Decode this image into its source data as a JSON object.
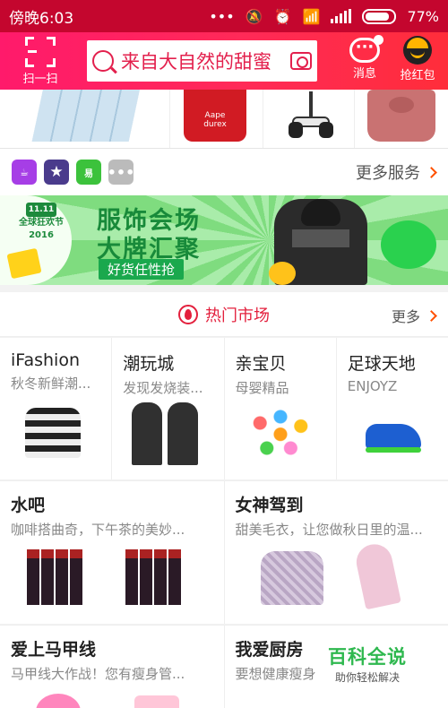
{
  "status_bar": {
    "time": "傍晚6:03",
    "icons": [
      "dots-icon",
      "mute-icon",
      "alarm-icon",
      "wifi-icon",
      "signal-icon",
      "battery-icon"
    ],
    "battery": "77%"
  },
  "header": {
    "scan_label": "扫一扫",
    "search_placeholder": "来自大自然的甜蜜",
    "message_label": "消息",
    "hongbao_label": "抢红包"
  },
  "product_strip": {
    "items": [
      "tissue-pack",
      "condom-box",
      "balance-scooter",
      "handbag"
    ],
    "aape_label": "Aape",
    "aape_sub": "durex"
  },
  "services": {
    "icons": [
      {
        "name": "tmall-ticket-icon",
        "glyph": "☕"
      },
      {
        "name": "star-icon",
        "glyph": "★"
      },
      {
        "name": "secondhand-icon",
        "glyph": "易"
      },
      {
        "name": "more-dots-icon",
        "glyph": "•••"
      }
    ],
    "more_label": "更多服务"
  },
  "banner": {
    "festival_line1": "11.11",
    "festival_line2": "全球狂欢节",
    "festival_line3": "2016",
    "title_line1": "服饰会场",
    "title_line2": "大牌汇聚",
    "tag": "好货任性抢"
  },
  "hot_market": {
    "title": "热门市场",
    "more_label": "更多"
  },
  "markets_row1": [
    {
      "title": "iFashion",
      "subtitle": "秋冬新鲜潮..."
    },
    {
      "title": "潮玩城",
      "subtitle": "发现发烧装..."
    },
    {
      "title": "亲宝贝",
      "subtitle": "母婴精品"
    },
    {
      "title": "足球天地",
      "subtitle": "ENJOYZ"
    }
  ],
  "markets_row2": [
    {
      "title": "水吧",
      "subtitle": "咖啡搭曲奇，下午茶的美妙..."
    },
    {
      "title": "女神驾到",
      "subtitle": "甜美毛衣，让您做秋日里的温..."
    }
  ],
  "markets_row3": [
    {
      "title": "爱上马甲线",
      "subtitle": "马甲线大作战！您有瘦身管..."
    },
    {
      "title": "我爱厨房",
      "subtitle": "要想健康瘦身"
    }
  ],
  "watermark": {
    "title": "百科全说",
    "subtitle": "助你轻松解决"
  },
  "colors": {
    "status_bar": "#c4062e",
    "header_start": "#ff1a6b",
    "header_end": "#ff2d3a",
    "accent_red": "#e3203d",
    "banner_green": "#188a3a"
  }
}
